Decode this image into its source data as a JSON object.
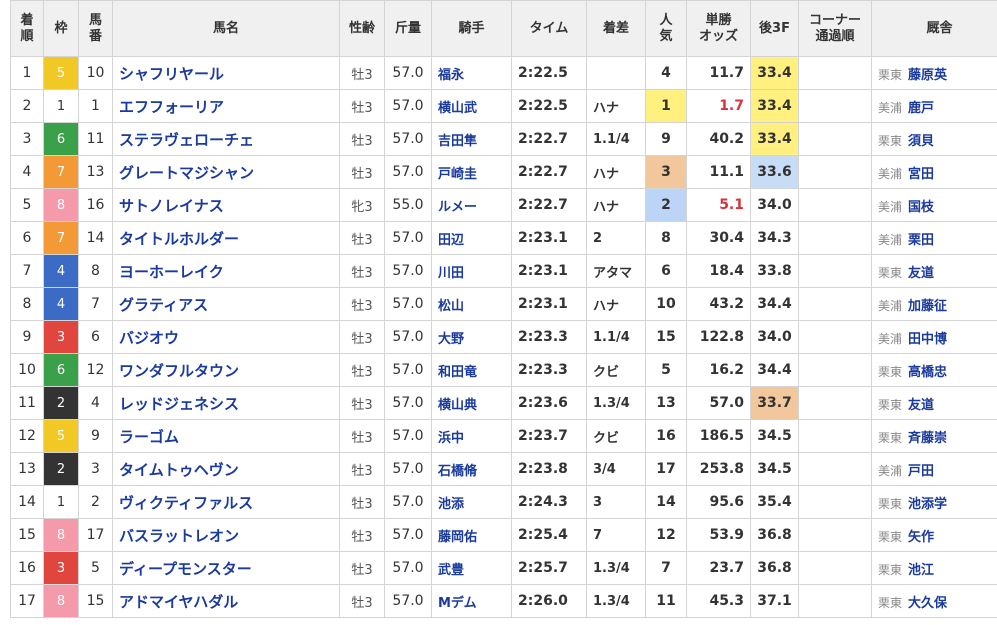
{
  "headers": [
    "着順",
    "枠",
    "馬番",
    "馬名",
    "性齢",
    "斤量",
    "騎手",
    "タイム",
    "着差",
    "人気",
    "単勝オッズ",
    "後3F",
    "コーナー通過順",
    "厩舎"
  ],
  "header_lines": [
    [
      "着",
      "順"
    ],
    [
      "枠"
    ],
    [
      "馬",
      "番"
    ],
    [
      "馬名"
    ],
    [
      "性齢"
    ],
    [
      "斤量"
    ],
    [
      "騎手"
    ],
    [
      "タイム"
    ],
    [
      "着差"
    ],
    [
      "人",
      "気"
    ],
    [
      "単勝",
      "オッズ"
    ],
    [
      "後3F"
    ],
    [
      "コーナー",
      "通過順"
    ],
    [
      "厩舎"
    ]
  ],
  "colors": {
    "waku": {
      "1": "#ffffff",
      "2": "#333333",
      "3": "#e0453e",
      "4": "#3b6bc4",
      "5": "#f2c824",
      "6": "#3aa04a",
      "7": "#f39a36",
      "8": "#f49aab"
    },
    "waku_text": {
      "1": "#333333",
      "2": "#ffffff",
      "3": "#ffffff",
      "4": "#ffffff",
      "5": "#ffffff",
      "6": "#ffffff",
      "7": "#ffffff",
      "8": "#ffffff"
    },
    "pop1": "#fff080",
    "pop2": "#bcd4f5",
    "pop3": "#f2c79c",
    "odds_fav": "#d6333f",
    "f3_1": "#fff080",
    "f3_2": "#c7dcf5",
    "f3_3": "#f2c79c"
  },
  "rows": [
    {
      "rank": "1",
      "waku": "5",
      "num": "10",
      "name": "シャフリヤール",
      "sexage": "牡3",
      "kinryo": "57.0",
      "jockey": "福永",
      "time": "2:22.5",
      "margin": "",
      "pop": "4",
      "odds": "11.7",
      "last3f": "33.4",
      "corner": "",
      "aff": "栗東",
      "trainer": "藤原英"
    },
    {
      "rank": "2",
      "waku": "1",
      "num": "1",
      "name": "エフフォーリア",
      "sexage": "牡3",
      "kinryo": "57.0",
      "jockey": "横山武",
      "time": "2:22.5",
      "margin": "ハナ",
      "pop": "1",
      "odds": "1.7",
      "last3f": "33.4",
      "corner": "",
      "aff": "美浦",
      "trainer": "鹿戸"
    },
    {
      "rank": "3",
      "waku": "6",
      "num": "11",
      "name": "ステラヴェローチェ",
      "sexage": "牡3",
      "kinryo": "57.0",
      "jockey": "吉田隼",
      "time": "2:22.7",
      "margin": "1.1/4",
      "pop": "9",
      "odds": "40.2",
      "last3f": "33.4",
      "corner": "",
      "aff": "栗東",
      "trainer": "須貝"
    },
    {
      "rank": "4",
      "waku": "7",
      "num": "13",
      "name": "グレートマジシャン",
      "sexage": "牡3",
      "kinryo": "57.0",
      "jockey": "戸崎圭",
      "time": "2:22.7",
      "margin": "ハナ",
      "pop": "3",
      "odds": "11.1",
      "last3f": "33.6",
      "corner": "",
      "aff": "美浦",
      "trainer": "宮田"
    },
    {
      "rank": "5",
      "waku": "8",
      "num": "16",
      "name": "サトノレイナス",
      "sexage": "牝3",
      "kinryo": "55.0",
      "jockey": "ルメー",
      "time": "2:22.7",
      "margin": "ハナ",
      "pop": "2",
      "odds": "5.1",
      "last3f": "34.0",
      "corner": "",
      "aff": "美浦",
      "trainer": "国枝"
    },
    {
      "rank": "6",
      "waku": "7",
      "num": "14",
      "name": "タイトルホルダー",
      "sexage": "牡3",
      "kinryo": "57.0",
      "jockey": "田辺",
      "time": "2:23.1",
      "margin": "2",
      "pop": "8",
      "odds": "30.4",
      "last3f": "34.3",
      "corner": "",
      "aff": "美浦",
      "trainer": "栗田"
    },
    {
      "rank": "7",
      "waku": "4",
      "num": "8",
      "name": "ヨーホーレイク",
      "sexage": "牡3",
      "kinryo": "57.0",
      "jockey": "川田",
      "time": "2:23.1",
      "margin": "アタマ",
      "pop": "6",
      "odds": "18.4",
      "last3f": "33.8",
      "corner": "",
      "aff": "栗東",
      "trainer": "友道"
    },
    {
      "rank": "8",
      "waku": "4",
      "num": "7",
      "name": "グラティアス",
      "sexage": "牡3",
      "kinryo": "57.0",
      "jockey": "松山",
      "time": "2:23.1",
      "margin": "ハナ",
      "pop": "10",
      "odds": "43.2",
      "last3f": "34.4",
      "corner": "",
      "aff": "美浦",
      "trainer": "加藤征"
    },
    {
      "rank": "9",
      "waku": "3",
      "num": "6",
      "name": "バジオウ",
      "sexage": "牡3",
      "kinryo": "57.0",
      "jockey": "大野",
      "time": "2:23.3",
      "margin": "1.1/4",
      "pop": "15",
      "odds": "122.8",
      "last3f": "34.0",
      "corner": "",
      "aff": "美浦",
      "trainer": "田中博"
    },
    {
      "rank": "10",
      "waku": "6",
      "num": "12",
      "name": "ワンダフルタウン",
      "sexage": "牡3",
      "kinryo": "57.0",
      "jockey": "和田竜",
      "time": "2:23.3",
      "margin": "クビ",
      "pop": "5",
      "odds": "16.2",
      "last3f": "34.4",
      "corner": "",
      "aff": "栗東",
      "trainer": "高橋忠"
    },
    {
      "rank": "11",
      "waku": "2",
      "num": "4",
      "name": "レッドジェネシス",
      "sexage": "牡3",
      "kinryo": "57.0",
      "jockey": "横山典",
      "time": "2:23.6",
      "margin": "1.3/4",
      "pop": "13",
      "odds": "57.0",
      "last3f": "33.7",
      "corner": "",
      "aff": "栗東",
      "trainer": "友道"
    },
    {
      "rank": "12",
      "waku": "5",
      "num": "9",
      "name": "ラーゴム",
      "sexage": "牡3",
      "kinryo": "57.0",
      "jockey": "浜中",
      "time": "2:23.7",
      "margin": "クビ",
      "pop": "16",
      "odds": "186.5",
      "last3f": "34.5",
      "corner": "",
      "aff": "栗東",
      "trainer": "斉藤崇"
    },
    {
      "rank": "13",
      "waku": "2",
      "num": "3",
      "name": "タイムトゥヘヴン",
      "sexage": "牡3",
      "kinryo": "57.0",
      "jockey": "石橋脩",
      "time": "2:23.8",
      "margin": "3/4",
      "pop": "17",
      "odds": "253.8",
      "last3f": "34.5",
      "corner": "",
      "aff": "美浦",
      "trainer": "戸田"
    },
    {
      "rank": "14",
      "waku": "1",
      "num": "2",
      "name": "ヴィクティファルス",
      "sexage": "牡3",
      "kinryo": "57.0",
      "jockey": "池添",
      "time": "2:24.3",
      "margin": "3",
      "pop": "14",
      "odds": "95.6",
      "last3f": "35.4",
      "corner": "",
      "aff": "栗東",
      "trainer": "池添学"
    },
    {
      "rank": "15",
      "waku": "8",
      "num": "17",
      "name": "バスラットレオン",
      "sexage": "牡3",
      "kinryo": "57.0",
      "jockey": "藤岡佑",
      "time": "2:25.4",
      "margin": "7",
      "pop": "12",
      "odds": "53.9",
      "last3f": "36.8",
      "corner": "",
      "aff": "栗東",
      "trainer": "矢作"
    },
    {
      "rank": "16",
      "waku": "3",
      "num": "5",
      "name": "ディープモンスター",
      "sexage": "牡3",
      "kinryo": "57.0",
      "jockey": "武豊",
      "time": "2:25.7",
      "margin": "1.3/4",
      "pop": "7",
      "odds": "23.7",
      "last3f": "36.8",
      "corner": "",
      "aff": "栗東",
      "trainer": "池江"
    },
    {
      "rank": "17",
      "waku": "8",
      "num": "15",
      "name": "アドマイヤハダル",
      "sexage": "牡3",
      "kinryo": "57.0",
      "jockey": "Mデム",
      "time": "2:26.0",
      "margin": "1.3/4",
      "pop": "11",
      "odds": "45.3",
      "last3f": "37.1",
      "corner": "",
      "aff": "栗東",
      "trainer": "大久保"
    }
  ],
  "highlight": {
    "pop_colors": {
      "1": "pop1",
      "2": "pop2",
      "3": "pop3"
    },
    "fav_odds_pops": [
      "1",
      "2"
    ],
    "last3f_ranks": {
      "33.4": "f3_1",
      "33.6": "f3_2",
      "33.7": "f3_3"
    }
  }
}
